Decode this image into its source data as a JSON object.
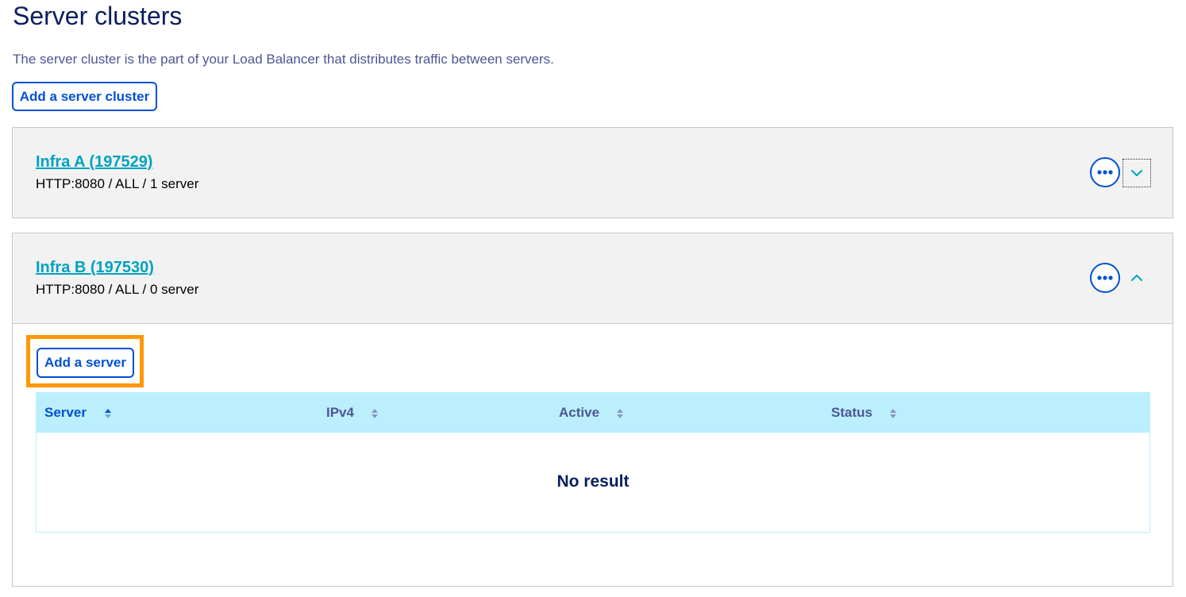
{
  "page": {
    "title": "Server clusters",
    "description": "The server cluster is the part of your Load Balancer that distributes traffic between servers.",
    "add_cluster_label": "Add a server cluster"
  },
  "clusters": [
    {
      "name": "Infra A (197529)",
      "summary": "HTTP:8080 / ALL / 1 server",
      "expanded": false
    },
    {
      "name": "Infra B (197530)",
      "summary": "HTTP:8080 / ALL / 0 server",
      "expanded": true,
      "add_server_label": "Add a server",
      "table": {
        "columns": [
          "Server",
          "IPv4",
          "Active",
          "Status"
        ],
        "empty_text": "No result"
      }
    }
  ],
  "icons": {
    "more": "ellipsis-icon",
    "expand": "chevron-down-icon",
    "collapse": "chevron-up-icon",
    "sort": "sort-icon"
  },
  "colors": {
    "primary": "#0050d7",
    "link": "#00a2bf",
    "title": "#0a1e5e",
    "highlight": "#ff9802",
    "table_header": "#bbeffd",
    "panel_header": "#f2f2f2"
  }
}
